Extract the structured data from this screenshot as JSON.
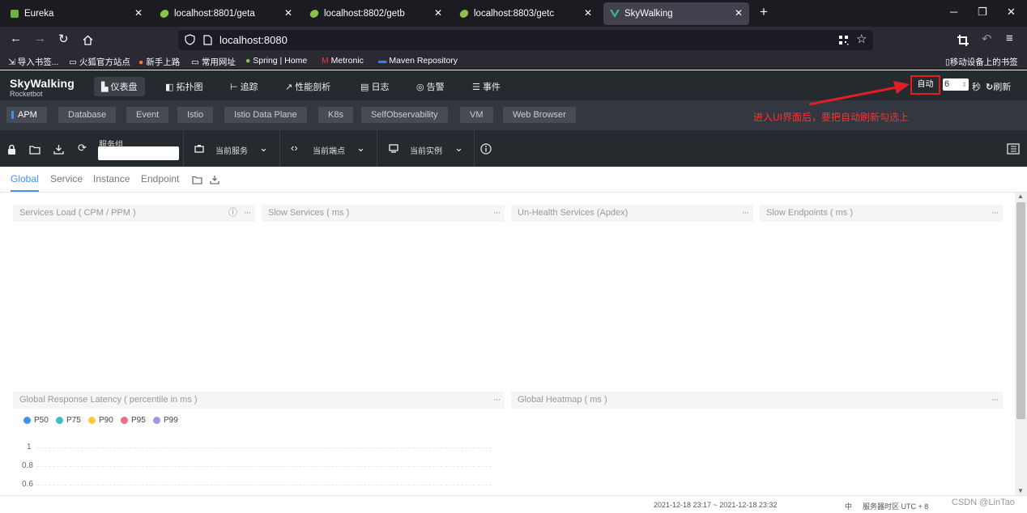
{
  "browser": {
    "tabs": [
      {
        "label": "Eureka",
        "icon": "eureka-icon"
      },
      {
        "label": "localhost:8801/geta",
        "icon": "spring-leaf-icon"
      },
      {
        "label": "localhost:8802/getb",
        "icon": "spring-leaf-icon"
      },
      {
        "label": "localhost:8803/getc",
        "icon": "spring-leaf-icon"
      },
      {
        "label": "SkyWalking",
        "icon": "vue-icon",
        "active": true
      }
    ],
    "url": "localhost:8080",
    "bookmarks": [
      "导入书签...",
      "火狐官方站点",
      "新手上路",
      "常用网址",
      "Spring | Home",
      "Metronic",
      "Maven Repository"
    ],
    "mobile_bookmarks": "移动设备上的书签"
  },
  "app": {
    "logo_title": "SkyWalking",
    "logo_subtitle": "Rocketbot",
    "nav": [
      "仪表盘",
      "拓扑图",
      "追踪",
      "性能剖析",
      "日志",
      "告警",
      "事件"
    ],
    "auto_label": "自动",
    "interval_value": "6",
    "interval_unit": "秒",
    "refresh_label": "刷新"
  },
  "layers": [
    "APM",
    "Database",
    "Event",
    "Istio",
    "Istio Data Plane",
    "K8s",
    "SelfObservability",
    "VM",
    "Web Browser"
  ],
  "annotation": "进入UI界面后，要把自动刷新勾选上",
  "selector": {
    "group_label": "服务组",
    "current_service": "当前服务",
    "current_endpoint": "当前端点",
    "current_instance": "当前实例"
  },
  "dashboard_tabs": [
    "Global",
    "Service",
    "Instance",
    "Endpoint"
  ],
  "panels": {
    "services_load": "Services Load ( CPM / PPM )",
    "slow_services": "Slow Services ( ms )",
    "unhealth_services": "Un-Health Services (Apdex)",
    "slow_endpoints": "Slow Endpoints ( ms )",
    "global_latency": "Global Response Latency ( percentile in ms )",
    "global_heatmap": "Global Heatmap ( ms )"
  },
  "chart_data": {
    "type": "line",
    "title": "Global Response Latency ( percentile in ms )",
    "series": [
      {
        "name": "P50",
        "color": "#3f96e6",
        "values": []
      },
      {
        "name": "P75",
        "color": "#3fbfc5",
        "values": []
      },
      {
        "name": "P90",
        "color": "#fec83e",
        "values": []
      },
      {
        "name": "P95",
        "color": "#f26c83",
        "values": []
      },
      {
        "name": "P99",
        "color": "#9c97e0",
        "values": []
      }
    ],
    "yticks": [
      "1",
      "0.8",
      "0.6"
    ],
    "ylim": [
      0.6,
      1
    ]
  },
  "footer": {
    "time_range": "2021-12-18 23:17 ~ 2021-12-18 23:32",
    "lang": "中",
    "timezone": "服务器时区 UTC + 8",
    "watermark": "CSDN @LinTao"
  },
  "colors": {
    "accent": "#448dfe",
    "annotation": "#e21e25"
  }
}
